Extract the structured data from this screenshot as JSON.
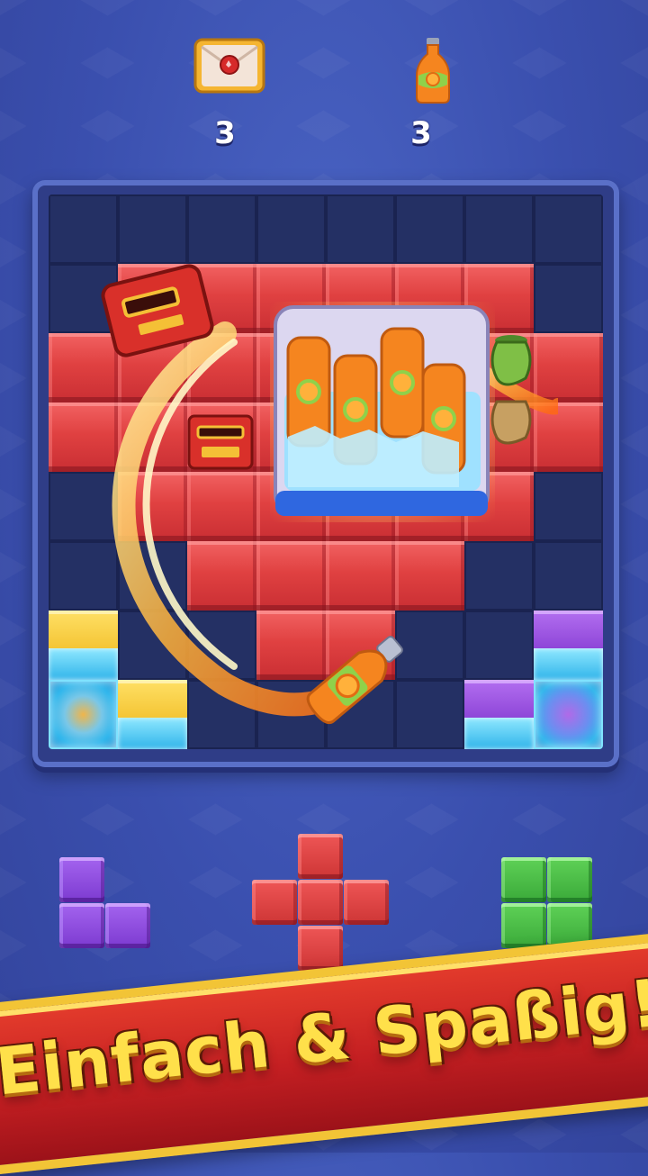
{
  "goals": [
    {
      "icon": "envelope-icon",
      "count": "3"
    },
    {
      "icon": "juice-bottle-icon",
      "count": "3"
    }
  ],
  "board": {
    "rows": [
      [
        "empty",
        "empty",
        "empty",
        "empty",
        "empty",
        "empty",
        "empty",
        "empty"
      ],
      [
        "empty",
        "red",
        "red",
        "red",
        "red",
        "red",
        "red",
        "empty"
      ],
      [
        "red",
        "red",
        "red",
        "red",
        "red",
        "red",
        "red",
        "red"
      ],
      [
        "red",
        "red",
        "red",
        "red",
        "red",
        "red",
        "red",
        "red"
      ],
      [
        "empty",
        "red",
        "red",
        "red",
        "red",
        "red",
        "red",
        "empty"
      ],
      [
        "empty",
        "empty",
        "red",
        "red",
        "red",
        "red",
        "empty",
        "empty"
      ],
      [
        "yellow-ice",
        "empty",
        "empty",
        "red",
        "red",
        "empty",
        "empty",
        "purple-ice"
      ],
      [
        "ice",
        "yellow-ice",
        "empty",
        "empty",
        "empty",
        "empty",
        "purple-ice-small",
        "ice-purple"
      ]
    ]
  },
  "pieces": [
    {
      "name": "purple-L-piece",
      "color": "#8e45d8"
    },
    {
      "name": "red-plus-piece",
      "color": "#d93a3a"
    },
    {
      "name": "green-square-piece",
      "color": "#44b640"
    }
  ],
  "banner": {
    "text": "Einfach & Spaßig!"
  },
  "colors": {
    "background": "#3a4fae",
    "banner_red": "#c41f22",
    "banner_text": "#ffe04a"
  }
}
